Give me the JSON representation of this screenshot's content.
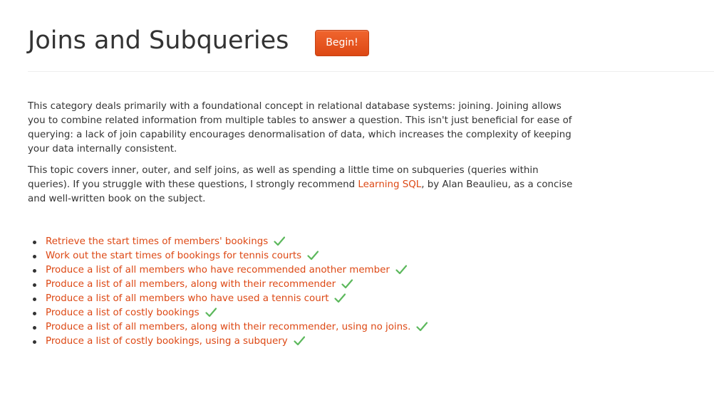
{
  "header": {
    "title": "Joins and Subqueries",
    "begin_label": "Begin!"
  },
  "intro": {
    "paragraph1": "This category deals primarily with a foundational concept in relational database systems: joining. Joining allows you to combine related information from multiple tables to answer a question. This isn't just beneficial for ease of querying: a lack of join capability encourages denormalisation of data, which increases the complexity of keeping your data internally consistent.",
    "paragraph2_before": "This topic covers inner, outer, and self joins, as well as spending a little time on subqueries (queries within queries). If you struggle with these questions, I strongly recommend ",
    "paragraph2_link": "Learning SQL",
    "paragraph2_after": ", by Alan Beaulieu, as a concise and well-written book on the subject."
  },
  "exercises": [
    {
      "label": "Retrieve the start times of members' bookings",
      "completed": true
    },
    {
      "label": "Work out the start times of bookings for tennis courts",
      "completed": true
    },
    {
      "label": "Produce a list of all members who have recommended another member",
      "completed": true
    },
    {
      "label": "Produce a list of all members, along with their recommender",
      "completed": true
    },
    {
      "label": "Produce a list of all members who have used a tennis court",
      "completed": true
    },
    {
      "label": "Produce a list of costly bookings",
      "completed": true
    },
    {
      "label": "Produce a list of all members, along with their recommender, using no joins.",
      "completed": true
    },
    {
      "label": "Produce a list of costly bookings, using a subquery",
      "completed": true
    }
  ],
  "colors": {
    "accent": "#dd4814",
    "check": "#5cb85c",
    "text": "#333333"
  },
  "icons": {
    "completed": "checkmark-icon"
  }
}
